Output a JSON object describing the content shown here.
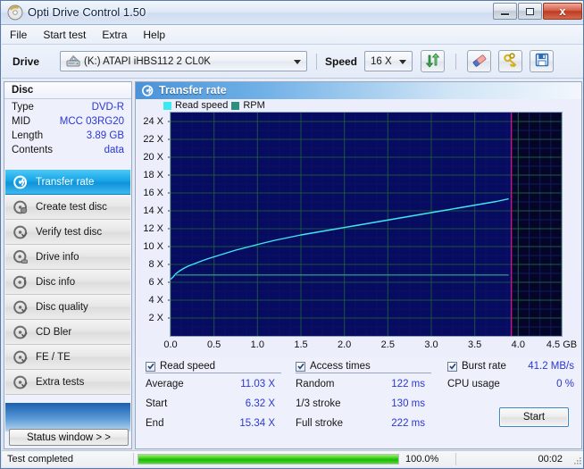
{
  "window": {
    "title": "Opti Drive Control 1.50",
    "icon": "disc-icon",
    "minimize_label": "Minimize",
    "maximize_label": "Maximize",
    "close_label": "x"
  },
  "menu": {
    "items": [
      {
        "label": "File"
      },
      {
        "label": "Start test"
      },
      {
        "label": "Extra"
      },
      {
        "label": "Help"
      }
    ]
  },
  "toolbar": {
    "drive_label": "Drive",
    "drive_value": "(K:)   ATAPI iHBS112  2 CL0K",
    "drive_icon": "optical-drive-icon",
    "speed_label": "Speed",
    "speed_value": "16 X",
    "refresh_icon": "refresh-arrows-icon",
    "erase_icon": "erase-disc-icon",
    "keys_icon": "disc-keys-icon",
    "save_icon": "save-floppy-icon"
  },
  "disc": {
    "header": "Disc",
    "rows": [
      {
        "key": "Type",
        "value": "DVD-R"
      },
      {
        "key": "MID",
        "value": "MCC 03RG20"
      },
      {
        "key": "Length",
        "value": "3.89 GB"
      },
      {
        "key": "Contents",
        "value": "data"
      }
    ]
  },
  "sidebar": {
    "items": [
      {
        "label": "Transfer rate",
        "icon": "disc-transfer-icon",
        "active": true
      },
      {
        "label": "Create test disc",
        "icon": "disc-create-icon",
        "active": false
      },
      {
        "label": "Verify test disc",
        "icon": "disc-verify-icon",
        "active": false
      },
      {
        "label": "Drive info",
        "icon": "disc-drive-icon",
        "active": false
      },
      {
        "label": "Disc info",
        "icon": "disc-info-icon",
        "active": false
      },
      {
        "label": "Disc quality",
        "icon": "disc-quality-icon",
        "active": false
      },
      {
        "label": "CD Bler",
        "icon": "disc-bler-icon",
        "active": false
      },
      {
        "label": "FE / TE",
        "icon": "disc-fete-icon",
        "active": false
      },
      {
        "label": "Extra tests",
        "icon": "disc-extra-icon",
        "active": false
      }
    ],
    "status_window_button": "Status window > >"
  },
  "panel": {
    "title": "Transfer rate",
    "icon": "disc-transfer-icon"
  },
  "results": {
    "read_speed": {
      "title": "Read speed",
      "checked": true,
      "rows": [
        {
          "key": "Average",
          "value": "11.03 X"
        },
        {
          "key": "Start",
          "value": "6.32 X"
        },
        {
          "key": "End",
          "value": "15.34 X"
        }
      ]
    },
    "access_times": {
      "title": "Access times",
      "checked": true,
      "rows": [
        {
          "key": "Random",
          "value": "122 ms"
        },
        {
          "key": "1/3 stroke",
          "value": "130 ms"
        },
        {
          "key": "Full stroke",
          "value": "222 ms"
        }
      ]
    },
    "burst": {
      "title": "Burst rate",
      "checked": true,
      "value": "41.2 MB/s",
      "cpu_key": "CPU usage",
      "cpu_value": "0 %"
    },
    "start_button": "Start"
  },
  "statusbar": {
    "message": "Test completed",
    "percent_label": "100.0%",
    "percent_value": 100,
    "elapsed": "00:02"
  },
  "chart_data": {
    "type": "line",
    "title": "Transfer rate",
    "xlabel": "GB",
    "ylabel": "X",
    "xlim": [
      0.0,
      4.5
    ],
    "ylim": [
      0,
      25
    ],
    "grid": true,
    "legend_position": "top-left",
    "plot_bg": "#050528",
    "xticks": [
      0.0,
      0.5,
      1.0,
      1.5,
      2.0,
      2.5,
      3.0,
      3.5,
      4.0,
      4.5
    ],
    "xtick_labels": [
      "0.0",
      "0.5",
      "1.0",
      "1.5",
      "2.0",
      "2.5",
      "3.0",
      "3.5",
      "4.0",
      "4.5 GB"
    ],
    "yticks": [
      2,
      4,
      6,
      8,
      10,
      12,
      14,
      16,
      18,
      20,
      22,
      24
    ],
    "ytick_labels": [
      "2 X",
      "4 X",
      "6 X",
      "8 X",
      "10 X",
      "12 X",
      "14 X",
      "16 X",
      "18 X",
      "20 X",
      "22 X",
      "24 X"
    ],
    "marker_x": 3.92,
    "marker_color": "#c71585",
    "series": [
      {
        "name": "Read speed",
        "color": "#3ee8f0",
        "points": [
          [
            0.0,
            6.32
          ],
          [
            0.03,
            6.6
          ],
          [
            0.06,
            6.95
          ],
          [
            0.1,
            7.25
          ],
          [
            0.15,
            7.55
          ],
          [
            0.2,
            7.8
          ],
          [
            0.28,
            8.1
          ],
          [
            0.36,
            8.4
          ],
          [
            0.45,
            8.7
          ],
          [
            0.55,
            9.0
          ],
          [
            0.65,
            9.3
          ],
          [
            0.75,
            9.6
          ],
          [
            0.85,
            9.85
          ],
          [
            0.95,
            10.1
          ],
          [
            1.05,
            10.35
          ],
          [
            1.2,
            10.7
          ],
          [
            1.35,
            11.0
          ],
          [
            1.5,
            11.3
          ],
          [
            1.65,
            11.55
          ],
          [
            1.8,
            11.8
          ],
          [
            1.95,
            12.05
          ],
          [
            2.1,
            12.3
          ],
          [
            2.25,
            12.55
          ],
          [
            2.4,
            12.8
          ],
          [
            2.55,
            13.05
          ],
          [
            2.7,
            13.3
          ],
          [
            2.85,
            13.55
          ],
          [
            3.0,
            13.8
          ],
          [
            3.15,
            14.05
          ],
          [
            3.3,
            14.3
          ],
          [
            3.45,
            14.55
          ],
          [
            3.6,
            14.8
          ],
          [
            3.75,
            15.05
          ],
          [
            3.89,
            15.34
          ]
        ]
      },
      {
        "name": "RPM",
        "color": "#2e8f7e",
        "points": [
          [
            0.05,
            6.82
          ],
          [
            1.0,
            6.82
          ],
          [
            1.05,
            6.82
          ],
          [
            2.3,
            6.82
          ],
          [
            3.89,
            6.82
          ]
        ]
      }
    ]
  }
}
